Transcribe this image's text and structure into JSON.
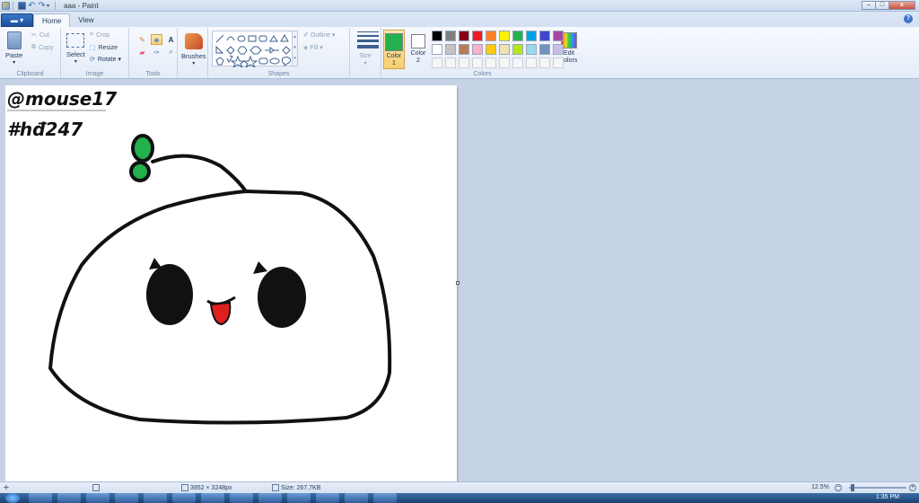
{
  "window": {
    "title": "aaa - Paint",
    "buttons": {
      "minimize": "–",
      "maximize": "□",
      "close": "x"
    }
  },
  "tabs": {
    "file": "▬ ▾",
    "home": "Home",
    "view": "View"
  },
  "ribbon": {
    "clipboard": {
      "label": "Clipboard",
      "paste": "Paste",
      "cut": "Cut",
      "copy": "Copy"
    },
    "image": {
      "label": "Image",
      "select": "Select",
      "crop": "Crop",
      "resize": "Resize",
      "rotate": "Rotate ▾"
    },
    "tools": {
      "label": "Tools",
      "text_tool": "A"
    },
    "brushes": {
      "label": "Brushes"
    },
    "shapes": {
      "label": "Shapes",
      "outline": "Outline ▾",
      "fill": "Fill ▾"
    },
    "size": {
      "label": "Size"
    },
    "colors": {
      "label": "Colors",
      "color1_label": "Color 1",
      "color2_label": "Color 2",
      "edit_colors": "Edit colors",
      "color1": "#22b14c",
      "color2": "#ffffff",
      "palette": [
        "#000000",
        "#7f7f7f",
        "#880015",
        "#ed1c24",
        "#ff7f27",
        "#fff200",
        "#22b14c",
        "#00a2e8",
        "#3f48cc",
        "#a349a4",
        "#ffffff",
        "#c3c3c3",
        "#b97a57",
        "#ffaec9",
        "#ffc90e",
        "#efe4b0",
        "#b5e61d",
        "#99d9ea",
        "#7092be",
        "#c8bfe7"
      ]
    }
  },
  "drawing": {
    "line1": "@mouse17",
    "line2": "#hđ247",
    "colors": {
      "ink": "#111111",
      "leaf": "#22b14c",
      "tongue": "#e01f1f"
    }
  },
  "status": {
    "position": "",
    "selection": "",
    "dimensions": "3952 × 3248px",
    "size": "Size: 267.7KB",
    "zoom": "12.5%",
    "zoom_out": "−",
    "zoom_in": "+"
  },
  "taskbar": {
    "clock": "1:35 PM"
  }
}
